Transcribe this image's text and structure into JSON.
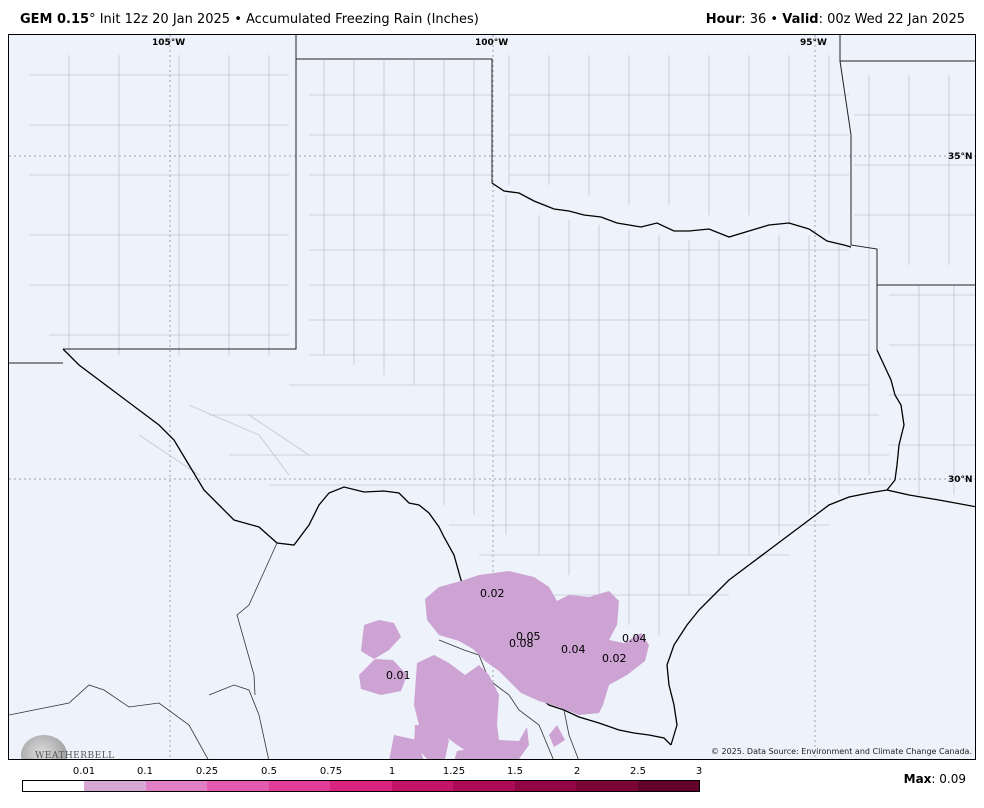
{
  "header": {
    "model": "GEM 0.15",
    "degree": "°",
    "init": " Init 12z 20 Jan 2025 • Accumulated Freezing Rain (Inches)",
    "hour_label": "Hour",
    "hour_value": ": 36 • ",
    "valid_label": "Valid",
    "valid_value": ": 00z Wed 22 Jan 2025"
  },
  "map": {
    "lon_labels": [
      "105°W",
      "100°W",
      "95°W"
    ],
    "lat_labels": [
      "35°N",
      "30°N"
    ],
    "value_labels": [
      "0.02",
      "0.05",
      "0.08",
      "0.04",
      "0.04",
      "0.02",
      "0.01"
    ],
    "copyright": "© 2025. Data Source: Environment and Climate Change Canada.",
    "logo_text": "WEATHERBELL",
    "shade_color": "#cda3d3",
    "background_color": "#eef2fa"
  },
  "legend": {
    "ticks": [
      "0.01",
      "0.1",
      "0.25",
      "0.5",
      "0.75",
      "1",
      "1.25",
      "1.5",
      "2",
      "2.5",
      "3"
    ],
    "colors": [
      "#ffffff",
      "#d9a9d6",
      "#e07fc4",
      "#e45aae",
      "#e23d98",
      "#d8237f",
      "#c41468",
      "#ac0b56",
      "#920644",
      "#7a0436",
      "#62022a"
    ],
    "max_label": "Max",
    "max_value": ": 0.09"
  }
}
